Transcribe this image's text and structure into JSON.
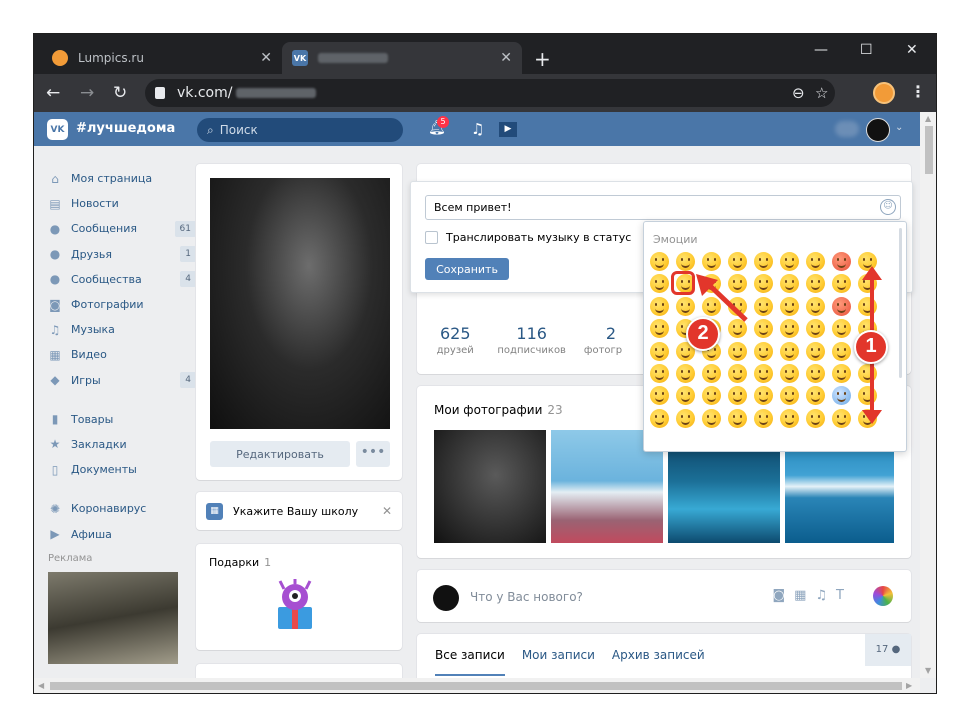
{
  "browser": {
    "tabs": [
      {
        "title": "Lumpics.ru",
        "close": "✕"
      },
      {
        "title": "",
        "close": "✕"
      }
    ],
    "new_tab": "+",
    "window_controls": [
      "—",
      "☐",
      "✕"
    ],
    "url_prefix": "vk.com/",
    "nav": {
      "back": "←",
      "forward": "→",
      "reload": "↻"
    }
  },
  "vk_header": {
    "logo": "VK",
    "hashtag": "#лучшедома",
    "search_placeholder": "Поиск",
    "notif_count": "5"
  },
  "sidebar": {
    "items": [
      {
        "label": "Моя страница",
        "icon": "home-icon",
        "glyph": "⌂",
        "count": ""
      },
      {
        "label": "Новости",
        "icon": "news-icon",
        "glyph": "▤",
        "count": ""
      },
      {
        "label": "Сообщения",
        "icon": "message-icon",
        "glyph": "●",
        "count": "61"
      },
      {
        "label": "Друзья",
        "icon": "friends-icon",
        "glyph": "●",
        "count": "1"
      },
      {
        "label": "Сообщества",
        "icon": "groups-icon",
        "glyph": "●",
        "count": "4"
      },
      {
        "label": "Фотографии",
        "icon": "camera-icon",
        "glyph": "◙",
        "count": ""
      },
      {
        "label": "Музыка",
        "icon": "music-icon",
        "glyph": "♫",
        "count": ""
      },
      {
        "label": "Видео",
        "icon": "video-icon",
        "glyph": "▦",
        "count": ""
      },
      {
        "label": "Игры",
        "icon": "gamepad-icon",
        "glyph": "◆",
        "count": "4"
      }
    ],
    "items2": [
      {
        "label": "Товары",
        "icon": "bag-icon",
        "glyph": "▮"
      },
      {
        "label": "Закладки",
        "icon": "star-icon",
        "glyph": "★"
      },
      {
        "label": "Документы",
        "icon": "document-icon",
        "glyph": "▯"
      }
    ],
    "items3": [
      {
        "label": "Коронавирус",
        "icon": "virus-icon",
        "glyph": "✺"
      },
      {
        "label": "Афиша",
        "icon": "play-circle-icon",
        "glyph": "▶"
      }
    ],
    "ad_label": "Реклама"
  },
  "profile": {
    "edit_label": "Редактировать",
    "more_label": "•••",
    "school_label": "Укажите Вашу школу",
    "gifts_label": "Подарки",
    "gifts_count": "1"
  },
  "status_form": {
    "value": "Всем привет!",
    "broadcast_label": "Транслировать музыку в статус",
    "save_label": "Сохранить"
  },
  "emoji_panel": {
    "title": "Эмоции"
  },
  "stats": [
    {
      "num": "625",
      "label": "друзей"
    },
    {
      "num": "116",
      "label": "подписчиков"
    },
    {
      "num": "2",
      "label": "фотогр"
    }
  ],
  "photos": {
    "title": "Мои фотографии",
    "count": "23"
  },
  "post": {
    "placeholder": "Что у Вас нового?"
  },
  "wall": {
    "tabs": [
      "Все записи",
      "Мои записи",
      "Архив записей"
    ],
    "count": "17"
  },
  "annotations": {
    "step1": "1",
    "step2": "2"
  },
  "colors": {
    "vk_blue": "#4a76a8",
    "annotation_red": "#e2362b"
  }
}
